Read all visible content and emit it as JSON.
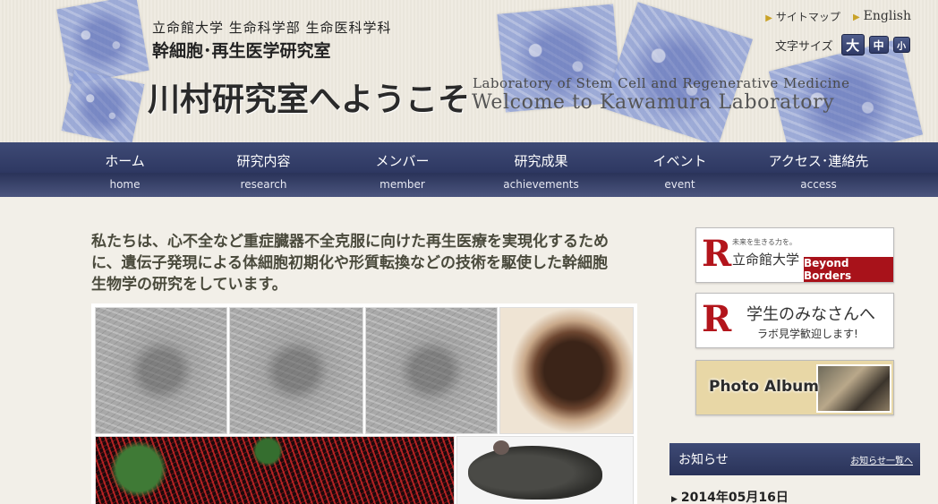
{
  "header": {
    "university": "立命館大学 生命科学部 生命医科学科",
    "lab_name_jp": "幹細胞･再生医学研究室",
    "welcome_jp": "川村研究室へようこそ",
    "lab_name_en": "Laboratory of Stem Cell and Regenerative Medicine",
    "welcome_en": "Welcome to Kawamura Laboratory",
    "links": {
      "sitemap": "サイトマップ",
      "english": "English"
    },
    "font_size": {
      "label": "文字サイズ",
      "large": "大",
      "medium": "中",
      "small": "小"
    }
  },
  "nav": [
    {
      "jp": "ホーム",
      "en": "home"
    },
    {
      "jp": "研究内容",
      "en": "research"
    },
    {
      "jp": "メンバー",
      "en": "member"
    },
    {
      "jp": "研究成果",
      "en": "achievements"
    },
    {
      "jp": "イベント",
      "en": "event"
    },
    {
      "jp": "アクセス･連絡先",
      "en": "access"
    }
  ],
  "main": {
    "intro": "私たちは、心不全など重症臓器不全克服に向けた再生医療を実現化するために、遺伝子発現による体細胞初期化や形質転換などの技術を駆使した幹細胞生物学の研究をしています。"
  },
  "sidebar": {
    "banner1": {
      "logo": "R",
      "tagline": "未来を生きる力を。",
      "name": "立命館大学",
      "badge": "Beyond Borders"
    },
    "banner2": {
      "logo": "R",
      "title": "学生のみなさんへ",
      "subtitle": "ラボ見学歓迎します!"
    },
    "banner3": {
      "title": "Photo Album"
    },
    "news": {
      "title": "お知らせ",
      "more": "お知らせ一覧へ",
      "first_date": "2014年05月16日"
    }
  },
  "colors": {
    "nav_bg": "#2e3862",
    "accent_red": "#b3151c",
    "arrow_gold": "#c9a227"
  }
}
